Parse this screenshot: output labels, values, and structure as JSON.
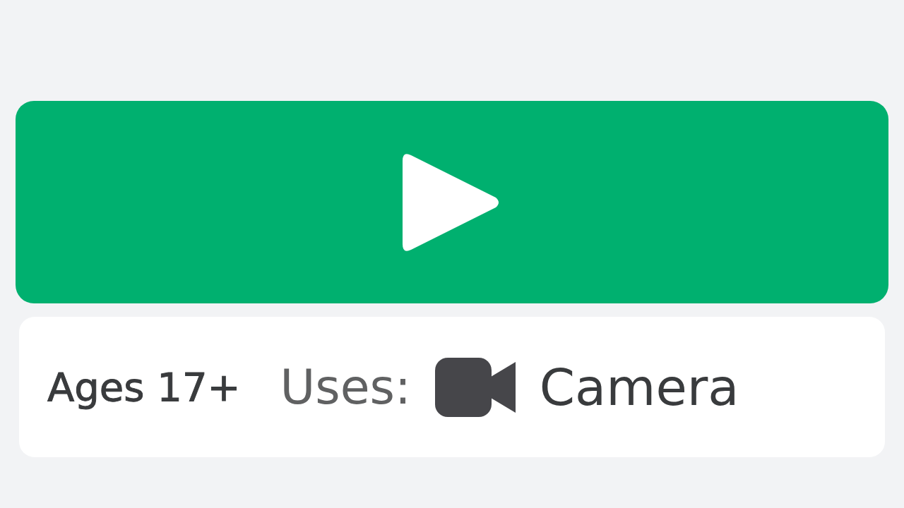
{
  "info": {
    "age_rating": "Ages 17+",
    "uses_label": "Uses:",
    "uses": [
      {
        "kind": "camera",
        "label": "Camera"
      }
    ]
  }
}
